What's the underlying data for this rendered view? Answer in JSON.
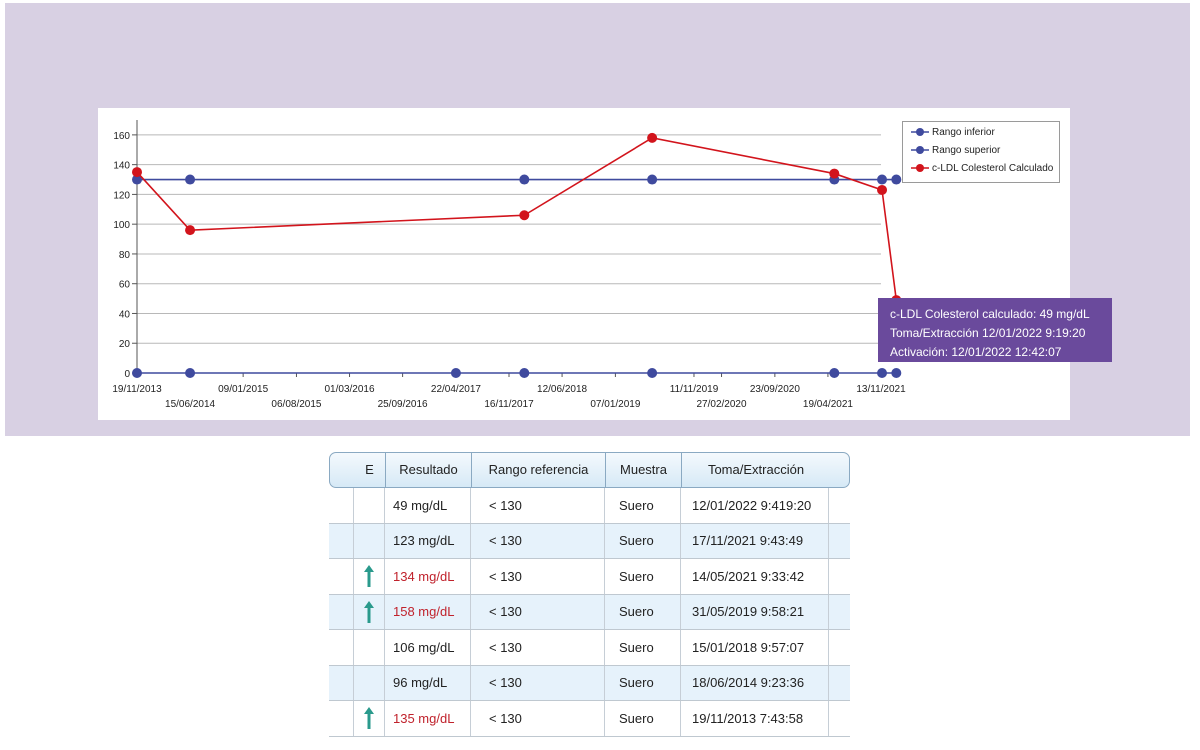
{
  "chart_data": {
    "type": "line",
    "x_tick_labels_row1": [
      "19/11/2013",
      "09/01/2015",
      "01/03/2016",
      "22/04/2017",
      "12/06/2018",
      "11/11/2019",
      "23/09/2020",
      "13/11/2021"
    ],
    "x_tick_labels_row2": [
      "15/06/2014",
      "06/08/2015",
      "25/09/2016",
      "16/11/2017",
      "07/01/2019",
      "27/02/2020",
      "19/04/2021"
    ],
    "y_ticks": [
      0,
      20,
      40,
      60,
      80,
      100,
      120,
      140,
      160
    ],
    "ylim": [
      0,
      170
    ],
    "grid": true,
    "legend_position": "top-right",
    "series": [
      {
        "name": "Rango inferior",
        "color": "#3f4a9e",
        "points": [
          [
            "19/11/2013",
            0
          ],
          [
            "15/06/2014",
            0
          ],
          [
            "22/04/2017",
            0
          ],
          [
            "15/01/2018",
            0
          ],
          [
            "31/05/2019",
            0
          ],
          [
            "14/05/2021",
            0
          ],
          [
            "17/11/2021",
            0
          ],
          [
            "12/01/2022",
            0
          ]
        ]
      },
      {
        "name": "Rango superior",
        "color": "#3f4a9e",
        "points": [
          [
            "19/11/2013",
            130
          ],
          [
            "15/06/2014",
            130
          ],
          [
            "15/01/2018",
            130
          ],
          [
            "31/05/2019",
            130
          ],
          [
            "14/05/2021",
            130
          ],
          [
            "17/11/2021",
            130
          ],
          [
            "12/01/2022",
            130
          ]
        ]
      },
      {
        "name": "c-LDL Colesterol Calculado",
        "color": "#d2141c",
        "points": [
          [
            "19/11/2013",
            135
          ],
          [
            "15/06/2014",
            96
          ],
          [
            "15/01/2018",
            106
          ],
          [
            "31/05/2019",
            158
          ],
          [
            "14/05/2021",
            134
          ],
          [
            "17/11/2021",
            123
          ],
          [
            "12/01/2022",
            49
          ]
        ]
      }
    ],
    "tooltip": [
      "c-LDL Colesterol calculado: 49 mg/dL",
      "Toma/Extracción 12/01/2022 9:19:20",
      "Activación: 12/01/2022 12:42:07"
    ]
  },
  "table": {
    "headers": [
      "E",
      "Resultado",
      "Rango referencia",
      "Muestra",
      "Toma/Extracción"
    ],
    "rows": [
      {
        "flag": "",
        "result": "49 mg/dL",
        "range": "< 130",
        "sample": "Suero",
        "date": "12/01/2022 9:419:20",
        "high": false
      },
      {
        "flag": "",
        "result": "123 mg/dL",
        "range": "< 130",
        "sample": "Suero",
        "date": "17/11/2021 9:43:49",
        "high": false
      },
      {
        "flag": "up-arrow-icon",
        "result": "134 mg/dL",
        "range": "< 130",
        "sample": "Suero",
        "date": "14/05/2021 9:33:42",
        "high": true
      },
      {
        "flag": "up-arrow-icon",
        "result": "158 mg/dL",
        "range": "< 130",
        "sample": "Suero",
        "date": "31/05/2019 9:58:21",
        "high": true
      },
      {
        "flag": "",
        "result": "106 mg/dL",
        "range": "< 130",
        "sample": "Suero",
        "date": "15/01/2018 9:57:07",
        "high": false
      },
      {
        "flag": "",
        "result": "96 mg/dL",
        "range": "< 130",
        "sample": "Suero",
        "date": "18/06/2014 9:23:36",
        "high": false
      },
      {
        "flag": "up-arrow-icon",
        "result": "135 mg/dL",
        "range": "< 130",
        "sample": "Suero",
        "date": "19/11/2013 7:43:58",
        "high": true
      }
    ],
    "colors": {
      "high": "#c0222c",
      "arrow": "#2a9a8c"
    }
  }
}
